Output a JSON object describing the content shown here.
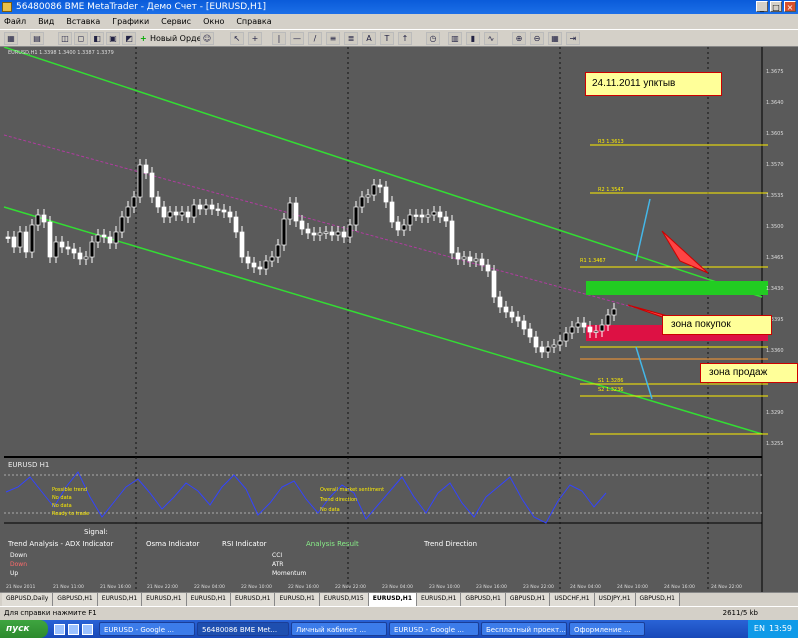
{
  "window": {
    "title": "56480086 BME MetaTrader - Демо Счет - [EURUSD,H1]",
    "buttons": [
      "_",
      "□",
      "×"
    ]
  },
  "menu": [
    "Файл",
    "Вид",
    "Вставка",
    "Графики",
    "Сервис",
    "Окно",
    "Справка"
  ],
  "toolbar": {
    "new_order": "Новый Ордер"
  },
  "chart": {
    "symbol_header": "EURUSD,H1 1.3398 1.3400 1.3387 1.3379",
    "note": "24.11.2011 упктыв",
    "buy_zone_label": "зона покупок",
    "sell_zone_label": "зона продаж",
    "colors": {
      "background": "#5a5a5a",
      "candle": "#ffffff",
      "channel": "#33dd33",
      "midline": "#b03ca0",
      "level": "#ffee00",
      "buy_zone": "#22cc22",
      "sell_zone": "#dd1144",
      "arrow": "#44b7e8",
      "callout_bg": "#ffff99",
      "callout_border": "#cc0000"
    },
    "levels": [
      "R3 1.3613",
      "R2 1.3547",
      "R1 1.3467",
      "S1 1.3286",
      "S2 1.3236"
    ],
    "price_scale": [
      "1.3675",
      "1.3640",
      "1.3605",
      "1.3570",
      "1.3535",
      "1.3500",
      "1.3465",
      "1.3430",
      "1.3395",
      "1.3360",
      "1.3325",
      "1.3290",
      "1.3255"
    ],
    "indicator": {
      "title": "EURUSD H1",
      "signal": "Signal:",
      "trend_analysis": "Trend Analysis - ADX Indicator",
      "osma": "Osma Indicator",
      "rsi": "RSI Indicator",
      "analysis_result": "Analysis Result",
      "trend_direction": "Trend Direction",
      "labels_left": [
        "Possible trend",
        "No data",
        "No data",
        "Ready to trade"
      ],
      "labels_right": [
        "Overall market sentiment",
        "Trend direction",
        "No data"
      ],
      "bottom_left": [
        "Down",
        "Down",
        "Up"
      ],
      "bottom_mid": [
        "CCI",
        "ATR",
        "Momentum"
      ]
    },
    "time_scale": [
      "21 Nov 2011",
      "21 Nov 11:00",
      "21 Nov 16:00",
      "21 Nov 22:00",
      "22 Nov 04:00",
      "22 Nov 10:00",
      "22 Nov 16:00",
      "22 Nov 22:00",
      "23 Nov 04:00",
      "23 Nov 10:00",
      "23 Nov 16:00",
      "23 Nov 22:00",
      "24 Nov 04:00",
      "24 Nov 10:00",
      "24 Nov 16:00",
      "24 Nov 22:00"
    ]
  },
  "chart_tabs": [
    "GBPUSD,Daily",
    "GBPUSD,H1",
    "EURUSD,H1",
    "EURUSD,H1",
    "EURUSD,H1",
    "EURUSD,H1",
    "EURUSD,H1",
    "EURUSD,M15",
    "EURUSD,H1",
    "EURUSD,H1",
    "GBPUSD,H1",
    "GBPUSD,H1",
    "USDCHF,H1",
    "USDJPY,H1",
    "GBPUSD,H1"
  ],
  "active_tab_index": 8,
  "status": {
    "left": "Для справки нажмите F1",
    "right": "2611/5 kb"
  },
  "taskbar": {
    "start": "пуск",
    "tasks": [
      "EURUSD - Google ...",
      "56480086 BME Met...",
      "Личный кабинет ...",
      "EURUSD - Google ...",
      "Бесплатный проект...",
      "Оформление ..."
    ],
    "active_task_index": 1,
    "tray_lang": "EN",
    "clock": "13:59"
  }
}
